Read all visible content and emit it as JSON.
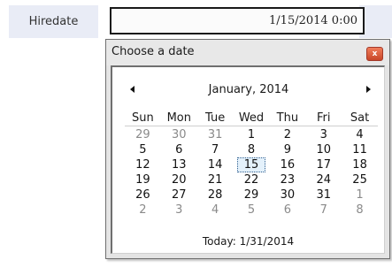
{
  "field": {
    "label": "Hiredate",
    "value": "1/15/2014 0:00"
  },
  "picker": {
    "title": "Choose a date",
    "close_icon": "close-icon",
    "close_glyph": "x",
    "month_title": "January, 2014",
    "prev_icon": "chevron-left-icon",
    "next_icon": "chevron-right-icon",
    "weekdays": [
      "Sun",
      "Mon",
      "Tue",
      "Wed",
      "Thu",
      "Fri",
      "Sat"
    ],
    "weeks": [
      [
        {
          "d": "29",
          "other": true
        },
        {
          "d": "30",
          "other": true
        },
        {
          "d": "31",
          "other": true
        },
        {
          "d": "1"
        },
        {
          "d": "2"
        },
        {
          "d": "3"
        },
        {
          "d": "4"
        }
      ],
      [
        {
          "d": "5"
        },
        {
          "d": "6"
        },
        {
          "d": "7"
        },
        {
          "d": "8"
        },
        {
          "d": "9"
        },
        {
          "d": "10"
        },
        {
          "d": "11"
        }
      ],
      [
        {
          "d": "12"
        },
        {
          "d": "13"
        },
        {
          "d": "14"
        },
        {
          "d": "15",
          "selected": true
        },
        {
          "d": "16"
        },
        {
          "d": "17"
        },
        {
          "d": "18"
        }
      ],
      [
        {
          "d": "19"
        },
        {
          "d": "20"
        },
        {
          "d": "21"
        },
        {
          "d": "22"
        },
        {
          "d": "23"
        },
        {
          "d": "24"
        },
        {
          "d": "25"
        }
      ],
      [
        {
          "d": "26"
        },
        {
          "d": "27"
        },
        {
          "d": "28"
        },
        {
          "d": "29"
        },
        {
          "d": "30"
        },
        {
          "d": "31"
        },
        {
          "d": "1",
          "other": true
        }
      ],
      [
        {
          "d": "2",
          "other": true
        },
        {
          "d": "3",
          "other": true
        },
        {
          "d": "4",
          "other": true
        },
        {
          "d": "5",
          "other": true
        },
        {
          "d": "6",
          "other": true
        },
        {
          "d": "7",
          "other": true
        },
        {
          "d": "8",
          "other": true
        }
      ]
    ],
    "today_label": "Today: 1/31/2014"
  },
  "colors": {
    "label_bg": "#e9ecf6",
    "close_button": "#d9573a",
    "selected_bg": "#e4f1fb",
    "other_month_text": "#8a8a8a"
  }
}
